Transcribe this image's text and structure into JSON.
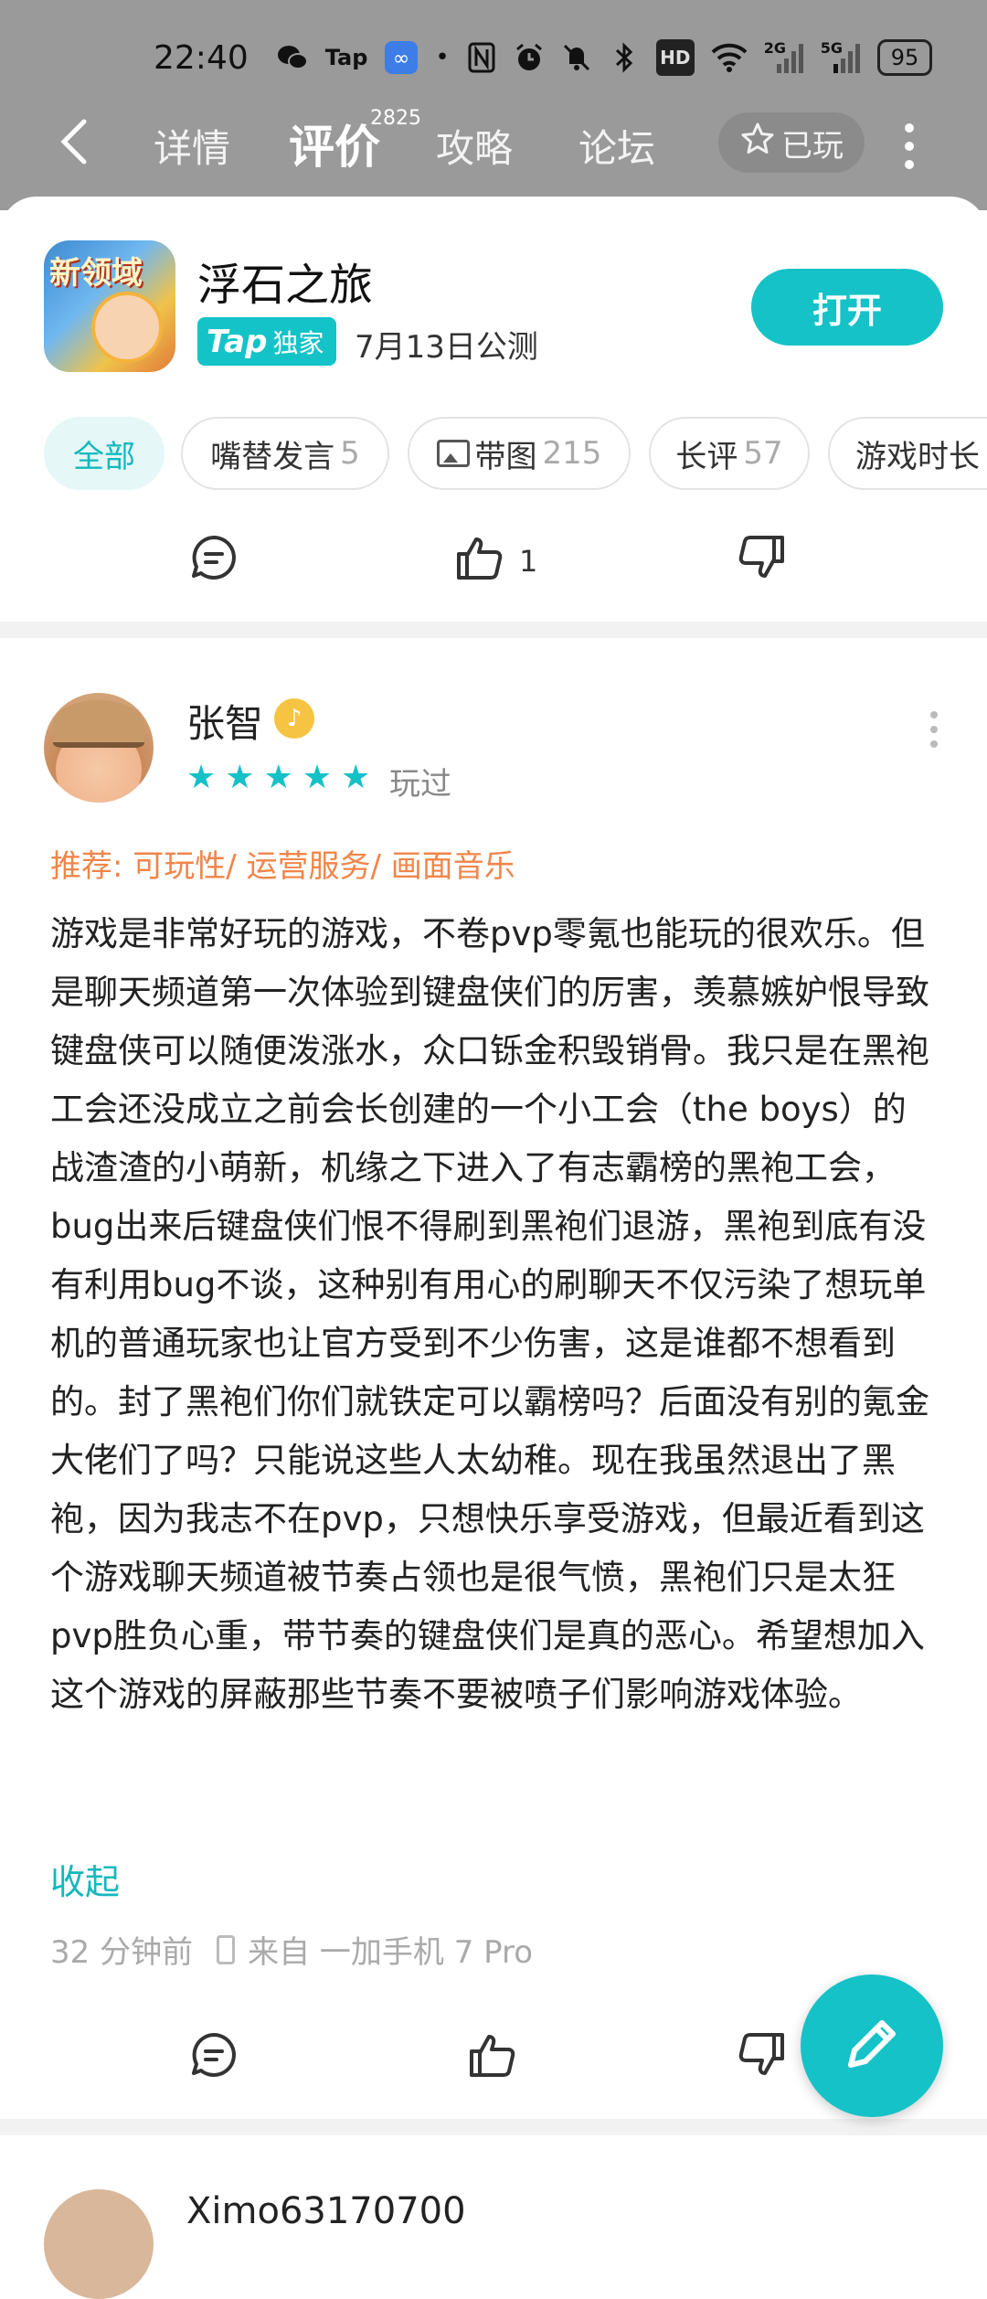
{
  "status_bar": {
    "time": "22:40",
    "icons": [
      "wechat-icon",
      "tap-icon",
      "loop-app-icon",
      "dot-icon",
      "nfc-icon",
      "alarm-icon",
      "mute-icon",
      "bluetooth-icon",
      "hd-icon",
      "wifi-icon",
      "signal-2g-icon",
      "signal-5g-icon"
    ],
    "hd_label": "HD",
    "sig1_label": "2G",
    "sig2_label": "5G",
    "battery": "95"
  },
  "nav": {
    "tabs": [
      {
        "label": "详情"
      },
      {
        "label": "评价",
        "count": "2825",
        "active": true
      },
      {
        "label": "攻略"
      },
      {
        "label": "论坛"
      }
    ],
    "played_label": "已玩"
  },
  "app": {
    "icon_text": "新领域",
    "title": "浮石之旅",
    "badge_logo": "Tap",
    "badge_text": "独家",
    "launch": "7月13日公测",
    "open_label": "打开"
  },
  "filters": [
    {
      "label": "全部",
      "count": "",
      "active": true
    },
    {
      "label": "嘴替发言",
      "count": "5"
    },
    {
      "label": "带图",
      "count": "215"
    },
    {
      "label": "长评",
      "count": "57"
    },
    {
      "label": "游戏时长",
      "count": ""
    }
  ],
  "prev_review": {
    "like_count": "1"
  },
  "review": {
    "username": "张智",
    "rating": 5,
    "status": "玩过",
    "tags": "推荐: 可玩性/ 运营服务/ 画面音乐",
    "content": "游戏是非常好玩的游戏，不卷pvp零氪也能玩的很欢乐。但是聊天频道第一次体验到键盘侠们的厉害，羡慕嫉妒恨导致键盘侠可以随便泼涨水，众口铄金积毁销骨。我只是在黑袍工会还没成立之前会长创建的一个小工会（the boys）的战渣渣的小萌新，机缘之下进入了有志霸榜的黑袍工会，bug出来后键盘侠们恨不得刷到黑袍们退游，黑袍到底有没有利用bug不谈，这种别有用心的刷聊天不仅污染了想玩单机的普通玩家也让官方受到不少伤害，这是谁都不想看到的。封了黑袍们你们就铁定可以霸榜吗？后面没有别的氪金大佬们了吗？只能说这些人太幼稚。现在我虽然退出了黑袍，因为我志不在pvp，只想快乐享受游戏，但最近看到这个游戏聊天频道被节奏占领也是很气愤，黑袍们只是太狂pvp胜负心重，带节奏的键盘侠们是真的恶心。希望想加入这个游戏的屏蔽那些节奏不要被喷子们影响游戏体验。",
    "collapse_label": "收起",
    "time_ago": "32 分钟前",
    "device": "来自 一加手机 7 Pro"
  },
  "next_review": {
    "username": "Ximo63170700 ",
    "partially_visible": true
  },
  "colors": {
    "accent": "#15c2c7",
    "tag_orange": "#f0854a",
    "header_gray": "#9a9a9a"
  }
}
